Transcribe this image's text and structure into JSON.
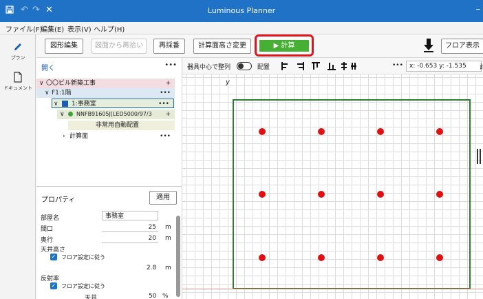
{
  "window": {
    "title": "Luminous Planner",
    "icons": [
      "save-icon",
      "undo-icon",
      "redo-icon",
      "close-icon"
    ],
    "minimize": "–"
  },
  "menu": [
    "ファイル(F)",
    "編集(E)",
    "表示(V)",
    "ヘルプ(H)"
  ],
  "leftbar": [
    {
      "icon": "pencil-icon",
      "label": "プラン"
    },
    {
      "icon": "document-icon",
      "label": "ドキュメント"
    }
  ],
  "toolbar": {
    "shape_edit": "図形編集",
    "recapture": "図面から再拾い",
    "renumber": "再採番",
    "calc_height": "計算面高さ変更",
    "calc": "▶  計算",
    "floor_view": "フロア表示"
  },
  "panel": {
    "open": "開く",
    "menu": "•••",
    "tree": [
      {
        "text": "〇〇ビル新築工事",
        "action": "+"
      },
      {
        "text": "F1:1階",
        "action": "•••"
      },
      {
        "text": "1:事務室",
        "action": "•••"
      },
      {
        "text": "NNFB91605J[LED5000/97/3",
        "action": "+"
      },
      {
        "text": "非常用自動配置",
        "action": ""
      },
      {
        "text": "計算面",
        "action": "•••"
      }
    ]
  },
  "properties": {
    "title": "プロパティ",
    "apply": "適用",
    "room_name_label": "部屋名",
    "room_name": "事務室",
    "frontage_label": "間口",
    "frontage": "25",
    "depth_label": "奥行",
    "depth": "20",
    "unit": "m",
    "ceiling_label": "天井高さ",
    "follow_floor": "フロア設定に従う",
    "ceiling_value": "2.8",
    "reflect_label": "反射率",
    "ceiling_refl_label": "天井",
    "ceiling_refl": "50",
    "percent": "%"
  },
  "viewbar": {
    "center_align": "器具中心で整列",
    "arrange": "配置",
    "more": "•••",
    "coords": "x: -0.653  y: -1.535",
    "calc_cut": "計"
  },
  "canvas": {
    "y_axis": "y",
    "luminaire_color": "#e01010",
    "room_color": "#2e7d32"
  }
}
